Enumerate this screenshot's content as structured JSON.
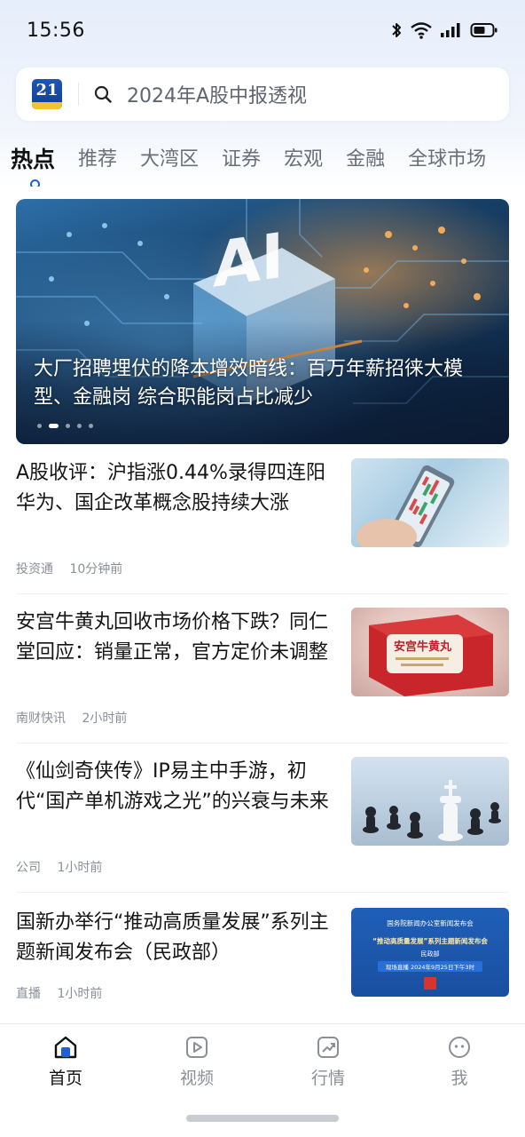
{
  "status_bar": {
    "time": "15:56",
    "icons": [
      "bluetooth-icon",
      "wifi-icon",
      "signal-icon",
      "battery-icon"
    ]
  },
  "search": {
    "logo_text": "21",
    "placeholder": "2024年A股中报透视"
  },
  "tabs": [
    {
      "label": "热点",
      "active": true
    },
    {
      "label": "推荐"
    },
    {
      "label": "大湾区"
    },
    {
      "label": "证券"
    },
    {
      "label": "宏观"
    },
    {
      "label": "金融"
    },
    {
      "label": "全球市场"
    }
  ],
  "hero": {
    "title": "大厂招聘埋伏的降本增效暗线：百万年薪招徕大模型、金融岗 综合职能岗占比减少",
    "image_text": "AI",
    "slide_count": 5,
    "active_slide": 2
  },
  "news": [
    {
      "title": "A股收评：沪指涨0.44%录得四连阳 华为、国企改革概念股持续大涨",
      "source": "投资通",
      "time": "10分钟前",
      "thumb": "phone-stock-chart-image"
    },
    {
      "title": "安宫牛黄丸回收市场价格下跌？同仁堂回应：销量正常，官方定价未调整",
      "source": "南财快讯",
      "time": "2小时前",
      "thumb": "medicine-box-image",
      "thumb_text": "安宫牛黄丸"
    },
    {
      "title": "《仙剑奇侠传》IP易主中手游，初代“国产单机游戏之光”的兴衰与未来",
      "source": "公司",
      "time": "1小时前",
      "thumb": "chess-pieces-image"
    },
    {
      "title": "国新办举行“推动高质量发展”系列主题新闻发布会（民政部）",
      "source": "直播",
      "time": "1小时前",
      "thumb": "press-conference-poster-image",
      "thumb_line1": "国务院新闻办公室新闻发布会",
      "thumb_line2": "“推动高质量发展”系列主题新闻发布会",
      "thumb_line3": "民政部",
      "thumb_line4": "现场直播 2024年9月25日下午3时"
    }
  ],
  "bottom_nav": [
    {
      "label": "首页",
      "icon": "home-icon",
      "active": true
    },
    {
      "label": "视频",
      "icon": "video-icon"
    },
    {
      "label": "行情",
      "icon": "market-chart-icon"
    },
    {
      "label": "我",
      "icon": "profile-icon"
    }
  ],
  "colors": {
    "accent": "#1f5fd6",
    "logo_blue": "#1a4aa6",
    "logo_yellow": "#f2c230"
  }
}
